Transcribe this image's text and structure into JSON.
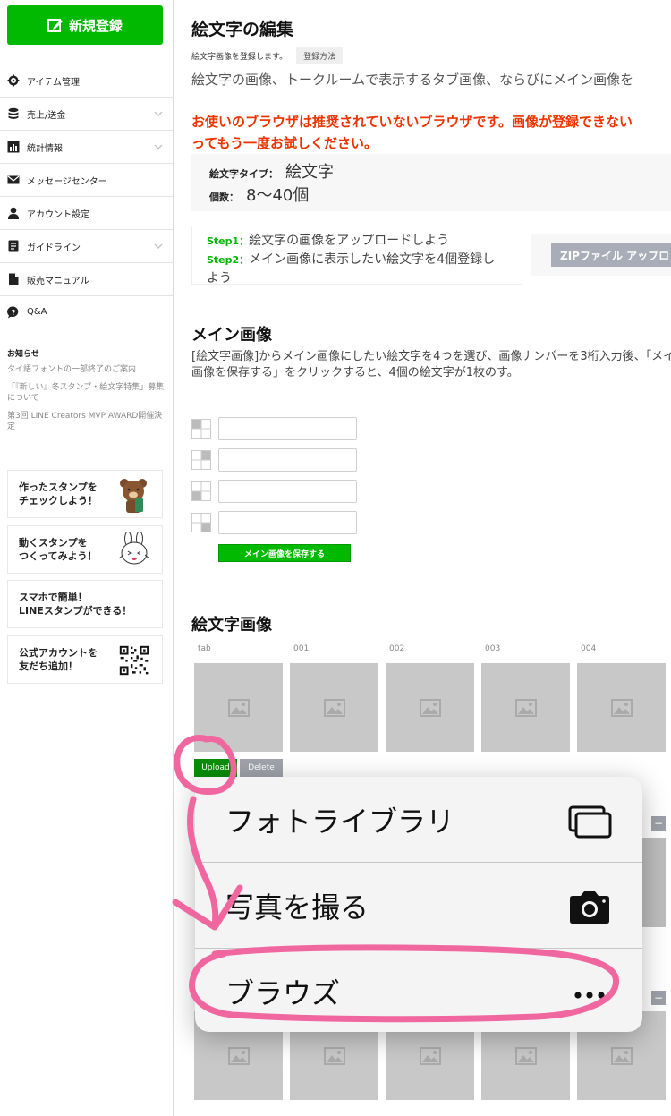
{
  "sidebar": {
    "new_button": "新規登録",
    "menu": [
      {
        "label": "アイテム管理",
        "icon": "gear-icon",
        "chevron": false
      },
      {
        "label": "売上/送金",
        "icon": "coins-icon",
        "chevron": true
      },
      {
        "label": "統計情報",
        "icon": "chart-icon",
        "chevron": true
      },
      {
        "label": "メッセージセンター",
        "icon": "mail-icon",
        "chevron": false
      },
      {
        "label": "アカウント設定",
        "icon": "user-icon",
        "chevron": false
      },
      {
        "label": "ガイドライン",
        "icon": "document-icon",
        "chevron": true
      },
      {
        "label": "販売マニュアル",
        "icon": "file-icon",
        "chevron": false
      },
      {
        "label": "Q&A",
        "icon": "question-icon",
        "chevron": false
      }
    ],
    "news_title": "お知らせ",
    "news": [
      "タイ語フォントの一部終了のご案内",
      "「『新しい』冬スタンプ・絵文字特集」募集について",
      "第3回 LINE Creators MVP AWARD開催決定"
    ],
    "promos": [
      {
        "line1": "作ったスタンプを",
        "line2": "チェックしよう！",
        "icon": "brown-bear-icon"
      },
      {
        "line1": "動くスタンプを",
        "line2": "つくってみよう！",
        "icon": "cony-rabbit-icon"
      },
      {
        "line1": "スマホで簡単！",
        "line2": "LINEスタンプができる！",
        "icon": ""
      },
      {
        "line1": "公式アカウントを",
        "line2": "友だち追加！",
        "icon": "qr-code-icon"
      }
    ]
  },
  "main": {
    "title": "絵文字の編集",
    "subtitle": "絵文字画像を登録します。",
    "howto_button": "登録方法",
    "description": "絵文字の画像、トークルームで表示するタブ画像、ならびにメイン画像を",
    "warning_line1": "お使いのブラウザは推奨されていないブラウザです。画像が登録できない",
    "warning_line2": "ってもう一度お試しください。",
    "info": {
      "type_label": "絵文字タイプ：",
      "type_value": "絵文字",
      "count_label": "個数：",
      "count_value": "8〜40個"
    },
    "steps": {
      "step1_label": "Step1：",
      "step1_text": "絵文字の画像をアップロードしよう",
      "step2_label": "Step2：",
      "step2_text": "メイン画像に表示したい絵文字を4個登録しよう"
    },
    "zip_button": "ZIPファイル アップロ",
    "main_image": {
      "title": "メイン画像",
      "description": "[絵文字画像]からメイン画像にしたい絵文字を4つを選び、画像ナンバーを3桁入力後、「メイン画像を保存する」をクリックすると、4個の絵文字が1枚のす。",
      "inputs": [
        "",
        "",
        "",
        ""
      ],
      "save_button": "メイン画像を保存する"
    },
    "emoji_images": {
      "title": "絵文字画像",
      "columns": [
        "tab",
        "001",
        "002",
        "003",
        "004"
      ],
      "upload_button": "Upload",
      "delete_button": "Delete"
    }
  },
  "sheet": {
    "items": [
      {
        "label": "フォトライブラリ",
        "icon": "photo-library-icon"
      },
      {
        "label": "写真を撮る",
        "icon": "camera-icon"
      },
      {
        "label": "ブラウズ",
        "icon": "more-icon"
      }
    ]
  },
  "colors": {
    "line_green": "#00b900",
    "warning_red": "#ee3300",
    "annotation_pink": "#f0679f"
  }
}
